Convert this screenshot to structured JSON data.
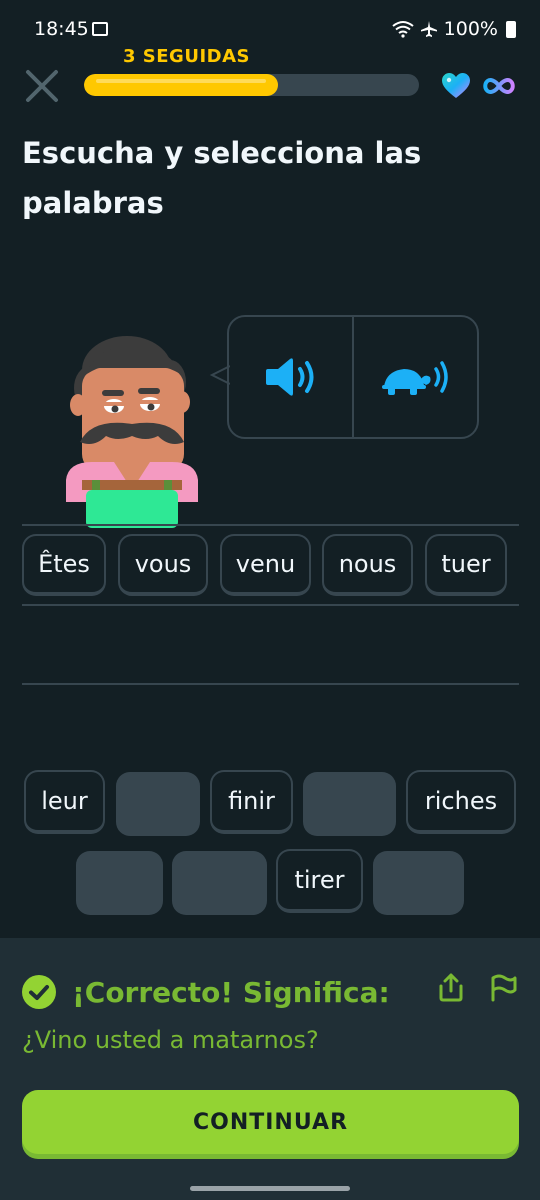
{
  "status_bar": {
    "time": "18:45",
    "battery": "100%"
  },
  "header": {
    "streak_label": "3 SEGUIDAS",
    "progress": 0.58
  },
  "prompt": {
    "title": "Escucha y selecciona las palabras"
  },
  "answer_words": [
    "Êtes",
    "vous",
    "venu",
    "nous",
    "tuer"
  ],
  "word_bank": {
    "row1": [
      {
        "text": "leur",
        "used": false
      },
      {
        "text": "",
        "used": true
      },
      {
        "text": "finir",
        "used": false
      },
      {
        "text": "",
        "used": true
      },
      {
        "text": "riches",
        "used": false
      }
    ],
    "row2": [
      {
        "text": "",
        "used": true
      },
      {
        "text": "",
        "used": true
      },
      {
        "text": "tirer",
        "used": false
      },
      {
        "text": "",
        "used": true
      }
    ]
  },
  "feedback": {
    "title": "¡Correcto! Significa:",
    "meaning": "¿Vino usted a matarnos?",
    "continue_label": "CONTINUAR"
  },
  "colors": {
    "background": "#131f24",
    "accent_green": "#93d333",
    "text_green": "#79b933",
    "streak_yellow": "#ffc800",
    "speaker_blue": "#1cb0f6"
  }
}
